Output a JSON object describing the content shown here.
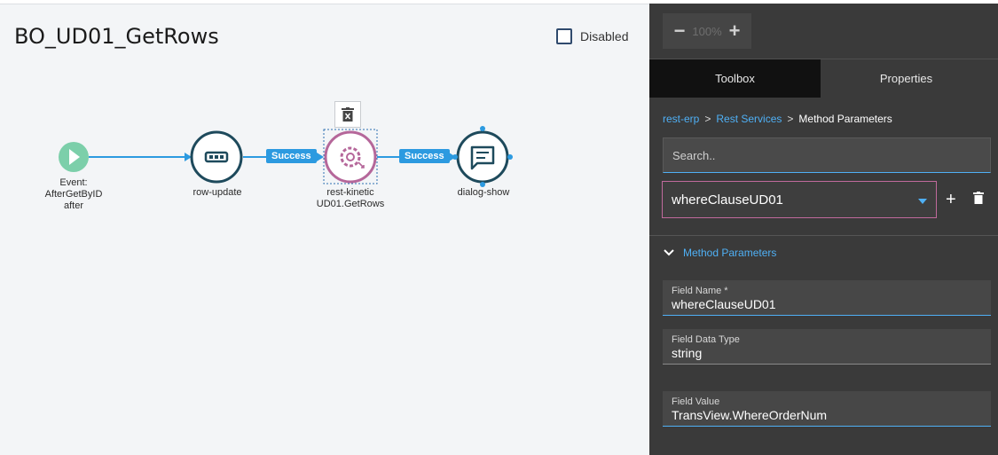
{
  "canvas": {
    "title": "BO_UD01_GetRows",
    "disabled_label": "Disabled",
    "nodes": {
      "event": {
        "label_lines": [
          "Event:",
          "AfterGetByID",
          "after"
        ]
      },
      "row_update": {
        "label": "row-update"
      },
      "rest_kinetic": {
        "label": "rest-kinetic",
        "sublabel": "UD01.GetRows"
      },
      "dialog_show": {
        "label": "dialog-show"
      }
    },
    "edges": [
      "Success",
      "Success"
    ]
  },
  "panel": {
    "zoom": {
      "minus": "−",
      "value": "100%",
      "plus": "+"
    },
    "tabs": [
      {
        "label": "Toolbox"
      },
      {
        "label": "Properties"
      }
    ],
    "breadcrumb": [
      "rest-erp",
      "Rest Services",
      "Method Parameters"
    ],
    "breadcrumb_sep": ">",
    "search_placeholder": "Search..",
    "selected_param": "whereClauseUD01",
    "add_label": "+",
    "section_title": "Method Parameters",
    "fields": {
      "field_name": {
        "label": "Field Name *",
        "value": "whereClauseUD01"
      },
      "field_data_type": {
        "label": "Field Data Type",
        "value": "string"
      },
      "field_value": {
        "label": "Field Value",
        "value": "TransView.WhereOrderNum"
      }
    }
  },
  "colors": {
    "accent_blue": "#4fb0f5",
    "node_dark": "#1e4a5c",
    "node_selected": "#b5679a",
    "event_green": "#7ccfaa",
    "edge_blue": "#2c9ae0"
  }
}
